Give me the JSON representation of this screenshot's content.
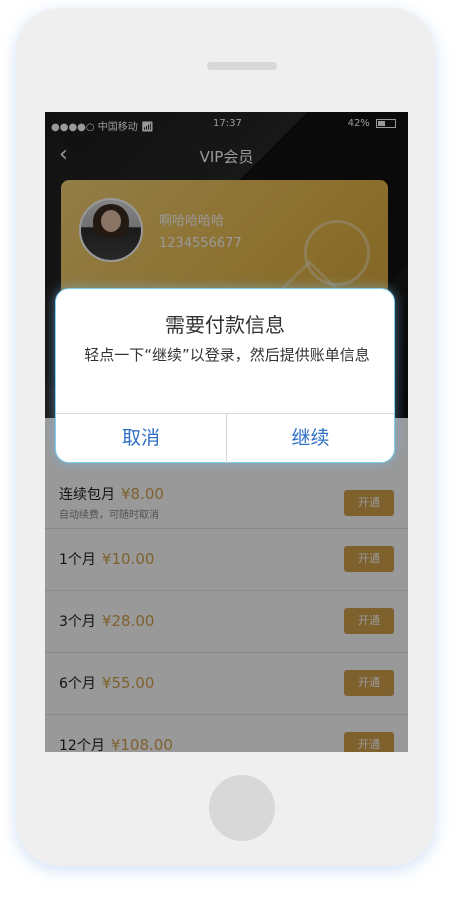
{
  "status_bar": {
    "carrier": "●●●●○ 中国移动",
    "wifi_icon": "wifi-icon",
    "time": "17:37",
    "battery_text": "42%",
    "battery_level": 0.42
  },
  "nav": {
    "back_icon": "chevron-left-icon",
    "title": "VIP会员"
  },
  "card": {
    "user_name": "啊哈哈哈哈",
    "user_id": "1234556677"
  },
  "plans": [
    {
      "name": "连续包月",
      "price": "¥8.00",
      "sub": "自动续费，可随时取消",
      "button": "开通"
    },
    {
      "name": "1个月",
      "price": "¥10.00",
      "button": "开通"
    },
    {
      "name": "3个月",
      "price": "¥28.00",
      "button": "开通"
    },
    {
      "name": "6个月",
      "price": "¥55.00",
      "button": "开通"
    },
    {
      "name": "12个月",
      "price": "¥108.00",
      "button": "开通"
    }
  ],
  "alert": {
    "title": "需要付款信息",
    "message": "轻点一下“继续”以登录，然后提供账单信息",
    "cancel": "取消",
    "continue": "继续"
  },
  "colors": {
    "accent_gold": "#d4a24c",
    "alert_button_blue": "#2f6fc6"
  }
}
